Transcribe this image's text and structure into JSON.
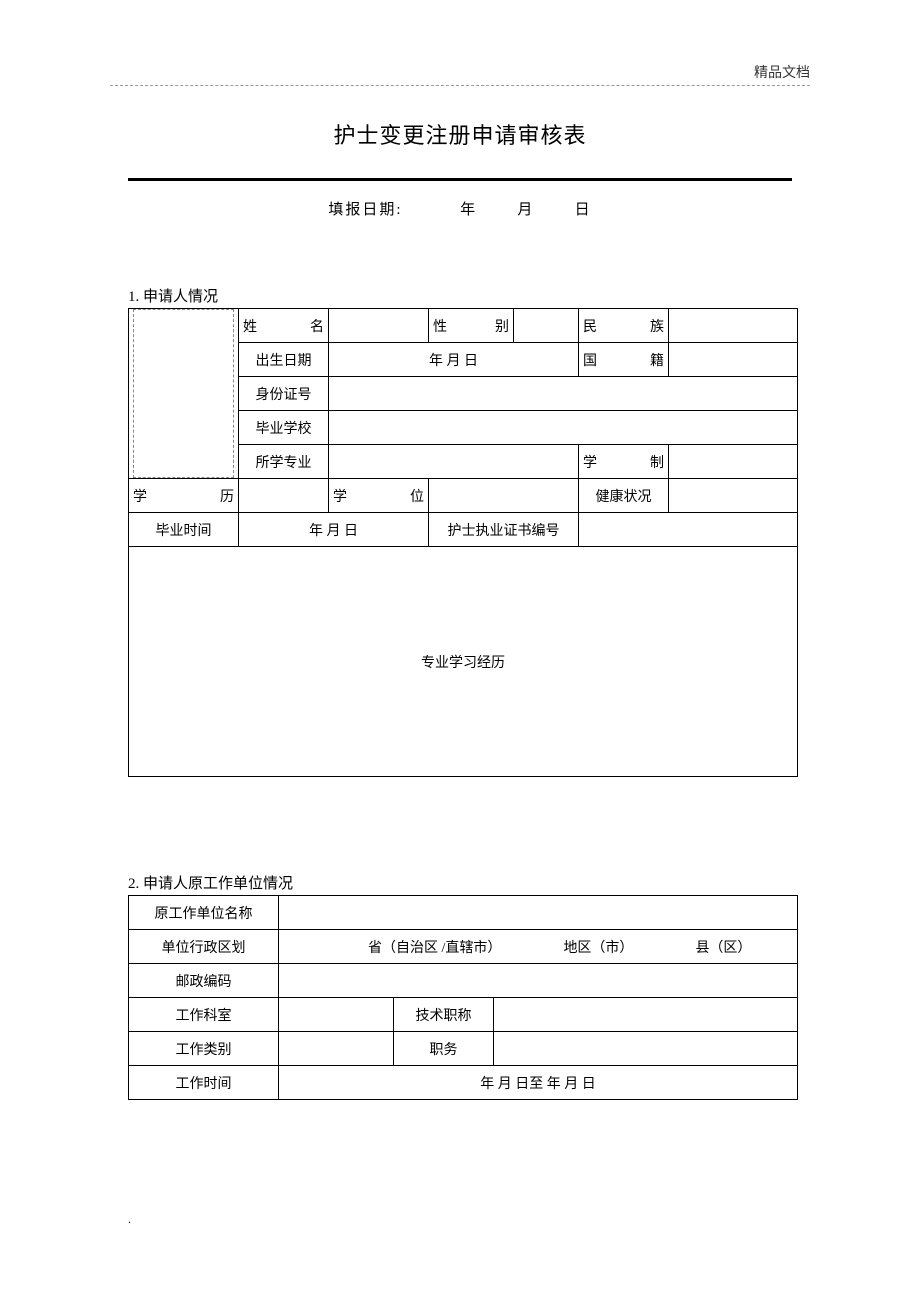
{
  "header": {
    "right": "精品文档"
  },
  "title": "护士变更注册申请审核表",
  "fill_date": {
    "label": "填报日期:",
    "year": "年",
    "month": "月",
    "day": "日"
  },
  "section1": {
    "heading": "1.  申请人情况",
    "labels": {
      "name": "姓名",
      "gender": "性别",
      "ethnicity": "民族",
      "birth_date": "出生日期",
      "birth_value": "年     月     日",
      "nationality": "国籍",
      "id_number": "身份证号",
      "school": "毕业学校",
      "major": "所学专业",
      "duration": "学制",
      "education": "学历",
      "degree": "学位",
      "health": "健康状况",
      "grad_time": "毕业时间",
      "grad_value": "年     月     日",
      "cert_no": "护士执业证书编号",
      "history": "专业学习经历"
    }
  },
  "section2": {
    "heading": "2.  申请人原工作单位情况",
    "labels": {
      "org_name": "原工作单位名称",
      "region": "单位行政区划",
      "region_value": {
        "province": "省（自治区 /直辖市）",
        "city": "地区（市）",
        "county": "县（区）"
      },
      "postcode": "邮政编码",
      "department": "工作科室",
      "tech_title": "技术职称",
      "work_type": "工作类别",
      "position": "职务",
      "work_time": "工作时间",
      "work_time_value": "年     月     日至          年     月     日"
    }
  },
  "footer": "."
}
